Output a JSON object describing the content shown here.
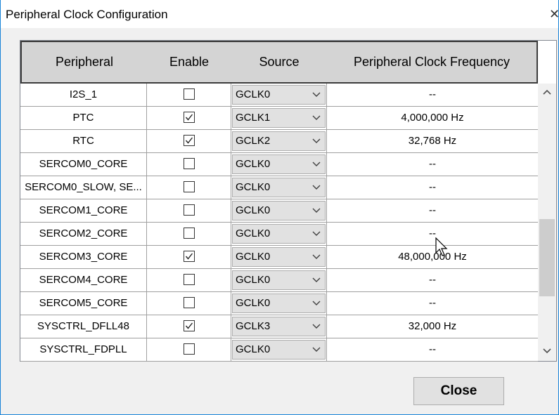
{
  "window": {
    "title": "Peripheral Clock Configuration",
    "close_glyph": "✕"
  },
  "table": {
    "headers": [
      "Peripheral",
      "Enable",
      "Source",
      "Peripheral Clock Frequency"
    ],
    "rows": [
      {
        "peripheral": "I2S_1",
        "enabled": false,
        "source": "GCLK0",
        "frequency": "--"
      },
      {
        "peripheral": "PTC",
        "enabled": true,
        "source": "GCLK1",
        "frequency": "4,000,000 Hz"
      },
      {
        "peripheral": "RTC",
        "enabled": true,
        "source": "GCLK2",
        "frequency": "32,768 Hz"
      },
      {
        "peripheral": "SERCOM0_CORE",
        "enabled": false,
        "source": "GCLK0",
        "frequency": "--"
      },
      {
        "peripheral": "SERCOM0_SLOW, SE...",
        "enabled": false,
        "source": "GCLK0",
        "frequency": "--"
      },
      {
        "peripheral": "SERCOM1_CORE",
        "enabled": false,
        "source": "GCLK0",
        "frequency": "--"
      },
      {
        "peripheral": "SERCOM2_CORE",
        "enabled": false,
        "source": "GCLK0",
        "frequency": "--"
      },
      {
        "peripheral": "SERCOM3_CORE",
        "enabled": true,
        "source": "GCLK0",
        "frequency": "48,000,000 Hz"
      },
      {
        "peripheral": "SERCOM4_CORE",
        "enabled": false,
        "source": "GCLK0",
        "frequency": "--"
      },
      {
        "peripheral": "SERCOM5_CORE",
        "enabled": false,
        "source": "GCLK0",
        "frequency": "--"
      },
      {
        "peripheral": "SYSCTRL_DFLL48",
        "enabled": true,
        "source": "GCLK3",
        "frequency": "32,000 Hz"
      },
      {
        "peripheral": "SYSCTRL_FDPLL",
        "enabled": false,
        "source": "GCLK0",
        "frequency": "--"
      }
    ]
  },
  "buttons": {
    "close_label": "Close"
  },
  "icons": {
    "checkbox_checked": "check-icon",
    "dropdown": "chevron-down-icon",
    "scroll_up": "chevron-up-icon",
    "scroll_down": "chevron-down-icon"
  }
}
